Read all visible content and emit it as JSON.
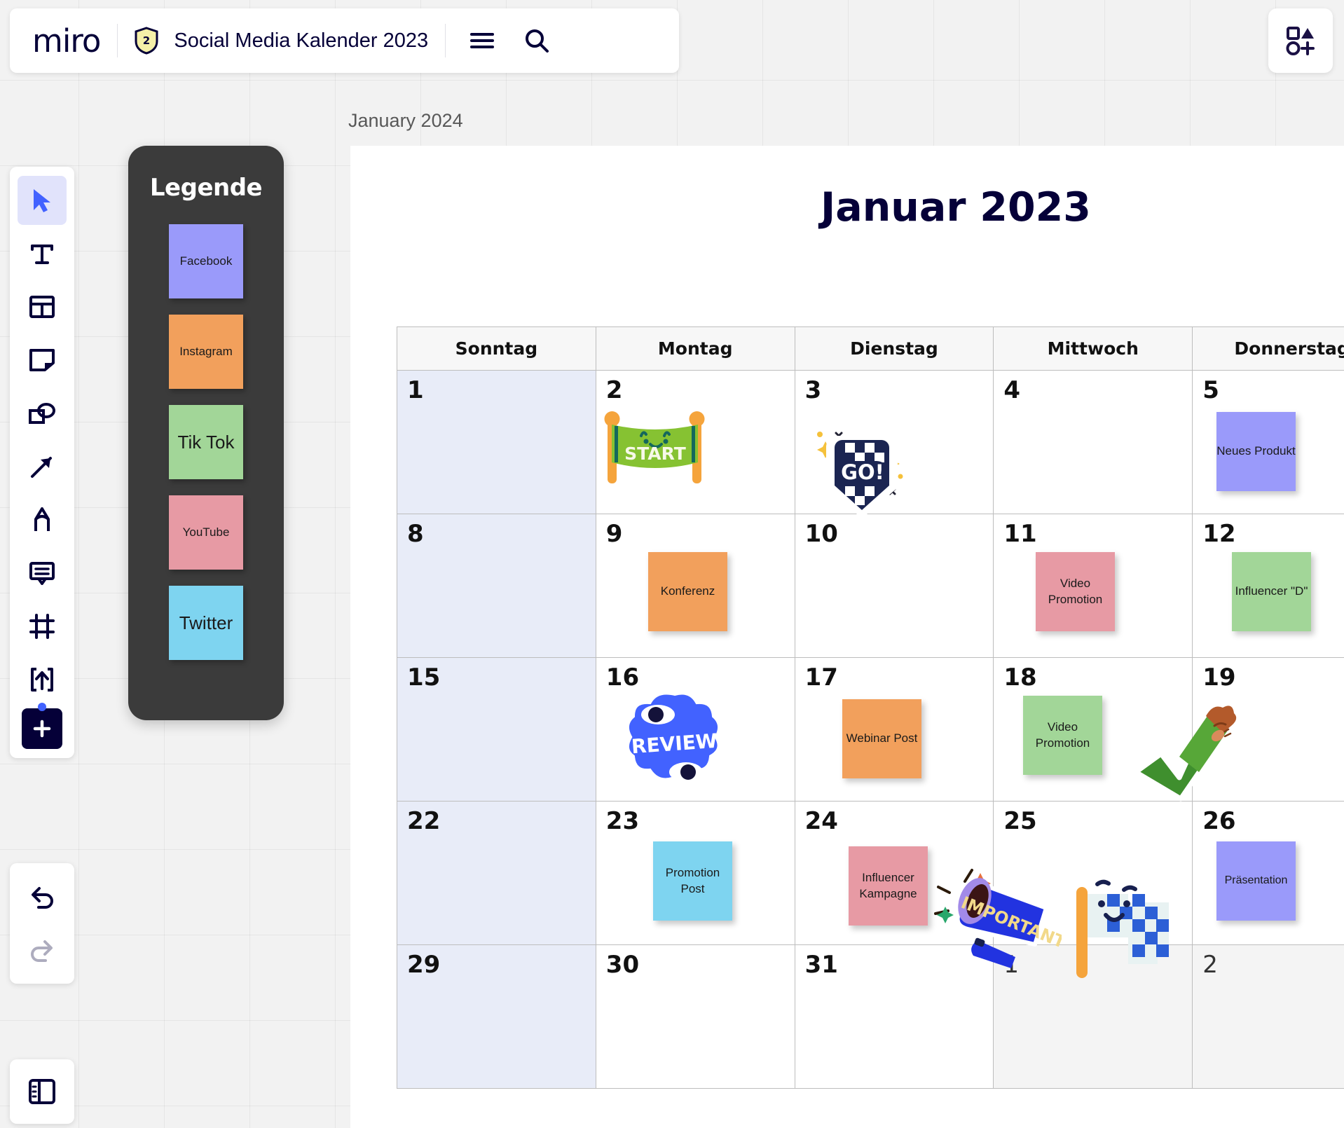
{
  "app": {
    "logo_text": "miro",
    "board_title": "Social Media Kalender 2023",
    "shield_badge": "2",
    "hamburger_icon": "hamburger-icon",
    "search_icon": "search-icon",
    "apps_icon": "apps-grid-icon"
  },
  "toolbar": {
    "tools": [
      {
        "name": "cursor-tool",
        "icon": "cursor-icon",
        "active": true
      },
      {
        "name": "text-tool",
        "icon": "text-icon",
        "active": false
      },
      {
        "name": "template-tool",
        "icon": "template-icon",
        "active": false
      },
      {
        "name": "sticky-note-tool",
        "icon": "sticky-note-icon",
        "active": false
      },
      {
        "name": "shapes-tool",
        "icon": "shapes-icon",
        "active": false
      },
      {
        "name": "connector-tool",
        "icon": "arrow-icon",
        "active": false
      },
      {
        "name": "pen-tool",
        "icon": "pen-icon",
        "active": false
      },
      {
        "name": "comment-tool",
        "icon": "comment-icon",
        "active": false
      },
      {
        "name": "frame-tool",
        "icon": "frame-icon",
        "active": false
      },
      {
        "name": "upload-tool",
        "icon": "upload-icon",
        "active": false
      },
      {
        "name": "more-apps-tool",
        "icon": "plus-icon",
        "active": false
      }
    ],
    "undo_icon": "undo-icon",
    "redo_icon": "redo-icon",
    "panel_icon": "side-panel-icon"
  },
  "legend": {
    "title": "Legende",
    "items": [
      {
        "label": "Facebook",
        "color": "#9a9afa",
        "size": "normal"
      },
      {
        "label": "Instagram",
        "color": "#f2a05c",
        "size": "normal"
      },
      {
        "label": "Tik Tok",
        "color": "#a2d698",
        "size": "large"
      },
      {
        "label": "YouTube",
        "color": "#e79aa4",
        "size": "normal"
      },
      {
        "label": "Twitter",
        "color": "#7ed4f0",
        "size": "large"
      }
    ]
  },
  "frame": {
    "label": "January 2024",
    "title": "Januar 2023"
  },
  "calendar": {
    "weekday_headers": [
      "Sonntag",
      "Montag",
      "Dienstag",
      "Mittwoch",
      "Donnerstag"
    ],
    "weeks": [
      {
        "days": [
          {
            "num": "1",
            "sunday": true
          },
          {
            "num": "2"
          },
          {
            "num": "3"
          },
          {
            "num": "4"
          },
          {
            "num": "5"
          }
        ]
      },
      {
        "days": [
          {
            "num": "8",
            "sunday": true
          },
          {
            "num": "9"
          },
          {
            "num": "10"
          },
          {
            "num": "11"
          },
          {
            "num": "12"
          }
        ]
      },
      {
        "days": [
          {
            "num": "15",
            "sunday": true
          },
          {
            "num": "16"
          },
          {
            "num": "17"
          },
          {
            "num": "18"
          },
          {
            "num": "19"
          }
        ]
      },
      {
        "days": [
          {
            "num": "22",
            "sunday": true
          },
          {
            "num": "23"
          },
          {
            "num": "24"
          },
          {
            "num": "25"
          },
          {
            "num": "26"
          }
        ]
      },
      {
        "days": [
          {
            "num": "29",
            "sunday": true
          },
          {
            "num": "30"
          },
          {
            "num": "31"
          },
          {
            "num": "1",
            "muted": true,
            "gray": true
          },
          {
            "num": "2",
            "muted": true,
            "gray": true
          }
        ]
      }
    ],
    "notes": [
      {
        "id": "note-neues-produkt",
        "label": "Neues Produkt",
        "color": "#9a9afa"
      },
      {
        "id": "note-konferenz",
        "label": "Konferenz",
        "color": "#f2a05c"
      },
      {
        "id": "note-video-promotion-11",
        "label": "Video Promotion",
        "color": "#e79aa4"
      },
      {
        "id": "note-influencer-d",
        "label": "Influencer \"D\"",
        "color": "#a2d698"
      },
      {
        "id": "note-webinar-post",
        "label": "Webinar Post",
        "color": "#f2a05c"
      },
      {
        "id": "note-video-promotion-18",
        "label": "Video Promotion",
        "color": "#a2d698"
      },
      {
        "id": "note-promotion-post",
        "label": "Promotion Post",
        "color": "#7ed4f0"
      },
      {
        "id": "note-influencer-kampagne",
        "label": "Influencer Kampagne",
        "color": "#e79aa4"
      },
      {
        "id": "note-praesentation",
        "label": "Präsentation",
        "color": "#9a9afa"
      }
    ],
    "stickers": [
      {
        "id": "sticker-start",
        "name": "start-banner-sticker",
        "text": "START"
      },
      {
        "id": "sticker-go",
        "name": "go-checkered-sticker",
        "text": "GO!"
      },
      {
        "id": "sticker-review",
        "name": "review-eyes-sticker",
        "text": "REVIEW"
      },
      {
        "id": "sticker-check",
        "name": "checkmark-hand-sticker",
        "text": ""
      },
      {
        "id": "sticker-important",
        "name": "megaphone-important-sticker",
        "text": "IMPORTANT"
      },
      {
        "id": "sticker-flag",
        "name": "checkered-flag-sticker",
        "text": ""
      }
    ]
  },
  "colors": {
    "brand_navy": "#050038",
    "accent_blue": "#4262ff",
    "sunday_tint": "#e8ecf8",
    "legend_bg": "#3b3b3b"
  }
}
